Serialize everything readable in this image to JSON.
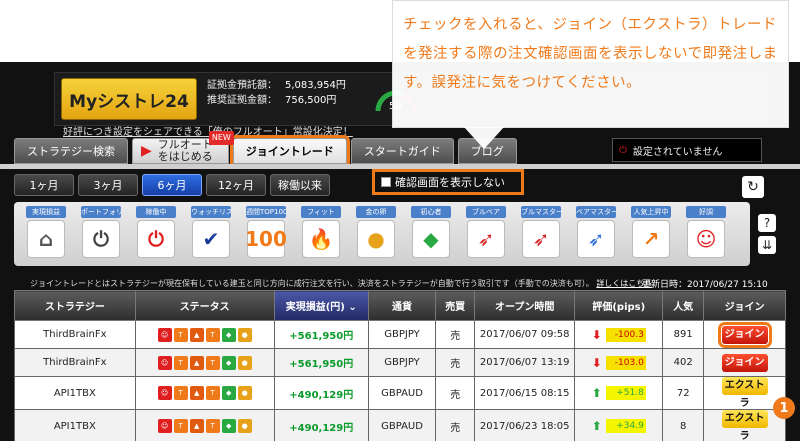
{
  "callout": {
    "text": "チェックを入れると、ジョイン（エクストラ）トレードを発注する際の注文確認画面を表示しないで即発注します。誤発注に気をつけてください。"
  },
  "header": {
    "logo": "Myシストレ24",
    "margin_label": "証拠金預託額：",
    "margin_value": "5,083,954円",
    "recommended_label": "推奨証拠金額：",
    "recommended_value": "756,500円",
    "gauge_value": "50",
    "share_link": "好評につき設定をシェアできる「俺のフルオート」常設化決定！"
  },
  "tabs": [
    {
      "label": "ストラテジー検索"
    },
    {
      "label": "フルオートをはじめる",
      "badge": "NEW"
    },
    {
      "label": "ジョイントレード"
    },
    {
      "label": "スタートガイド"
    },
    {
      "label": "ブログ"
    }
  ],
  "not_set": "設定されていません",
  "periods": [
    "1ヶ月",
    "3ヶ月",
    "6ヶ月",
    "12ヶ月",
    "稼働以来"
  ],
  "confirm_label": "確認画面を表示しない",
  "icons": [
    {
      "label": "実現損益",
      "glyph": "⌂",
      "color": "#555"
    },
    {
      "label": "ポートフォリオ",
      "glyph": "⏻",
      "color": "#444"
    },
    {
      "label": "稼働中",
      "glyph": "⏻",
      "color": "#e02020"
    },
    {
      "label": "ウォッチリスト",
      "glyph": "✔",
      "color": "#1b3c9a"
    },
    {
      "label": "週間TOP100",
      "glyph": "100",
      "color": "#f07a1a"
    },
    {
      "label": "フィット",
      "glyph": "🔥",
      "color": "#e05a10"
    },
    {
      "label": "金の卵",
      "glyph": "●",
      "color": "#e8a21a"
    },
    {
      "label": "初心者",
      "glyph": "◆",
      "color": "#2aa842"
    },
    {
      "label": "ブルベア",
      "glyph": "➶",
      "color": "#d82020"
    },
    {
      "label": "ブルマスター",
      "glyph": "➶",
      "color": "#d82020"
    },
    {
      "label": "ベアマスター",
      "glyph": "➶",
      "color": "#2b6bd8"
    },
    {
      "label": "人気上昇中",
      "glyph": "↗",
      "color": "#f07a1a"
    },
    {
      "label": "好調",
      "glyph": "☺",
      "color": "#e02020"
    }
  ],
  "info_text": "ジョイントレードとはストラテジーが現在保有している建玉と同じ方向に成行注文を行い、決済をストラテジーが自動で行う取引です（手動での決済も可）。",
  "info_link": "詳しくはこちら",
  "updated": "更新日時：2017/06/27 15:10",
  "table": {
    "headers": [
      "ストラテジー",
      "ステータス",
      "実現損益(円)",
      "通貨",
      "売買",
      "オープン時間",
      "評価(pips)",
      "人気",
      "ジョイン"
    ],
    "rows": [
      {
        "strategy": "ThirdBrainFx",
        "profit": "+561,950円",
        "currency": "GBPJPY",
        "side": "売",
        "open": "2017/06/07 09:58",
        "pips": "-100.3",
        "dir": "down",
        "pop": "891",
        "action": "ジョイン",
        "type": "red"
      },
      {
        "strategy": "ThirdBrainFx",
        "profit": "+561,950円",
        "currency": "GBPJPY",
        "side": "売",
        "open": "2017/06/07 13:19",
        "pips": "-103.0",
        "dir": "down",
        "pop": "402",
        "action": "ジョイン",
        "type": "red"
      },
      {
        "strategy": "API1TBX",
        "profit": "+490,129円",
        "currency": "GBPAUD",
        "side": "売",
        "open": "2017/06/15 08:15",
        "pips": "+51.8",
        "dir": "up",
        "pop": "72",
        "action": "エクストラ",
        "type": "yellow"
      },
      {
        "strategy": "API1TBX",
        "profit": "+490,129円",
        "currency": "GBPAUD",
        "side": "売",
        "open": "2017/06/23 18:05",
        "pips": "+34.9",
        "dir": "up",
        "pop": "8",
        "action": "エクストラ",
        "type": "yellow"
      }
    ]
  },
  "marker": "1"
}
